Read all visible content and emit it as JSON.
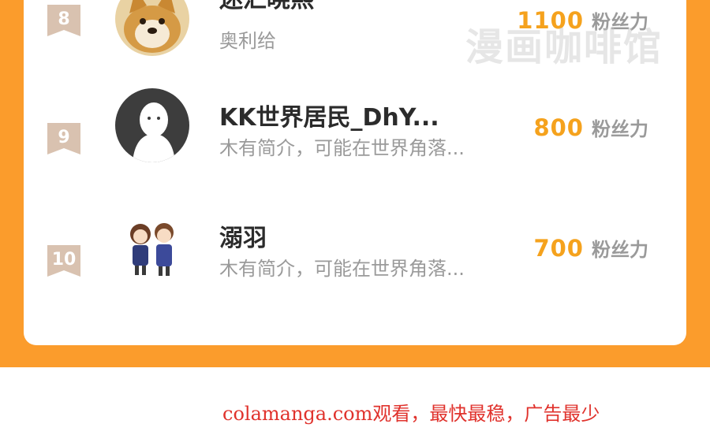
{
  "fans_unit": "粉丝力",
  "rows": [
    {
      "rank": "8",
      "name": "迷汇晓熙",
      "bio": "奥利给",
      "fans": "1100",
      "avatar": "shiba-dog-avatar"
    },
    {
      "rank": "9",
      "name": "KK世界居民_DhY...",
      "bio": "木有简介，可能在世界角落...",
      "fans": "800",
      "avatar": "default-person-avatar"
    },
    {
      "rank": "10",
      "name": "溺羽",
      "bio": "木有简介，可能在世界角落...",
      "fans": "700",
      "avatar": "anime-couple-avatar"
    }
  ],
  "watermark": "漫画咖啡馆",
  "footer": "colamanga.com观看，最快最稳，广告最少",
  "colors": {
    "accent_orange": "#fb9c2c",
    "fans_number": "#f5a21d",
    "footer_red": "#e0322c",
    "badge": "#d9c2b0"
  }
}
